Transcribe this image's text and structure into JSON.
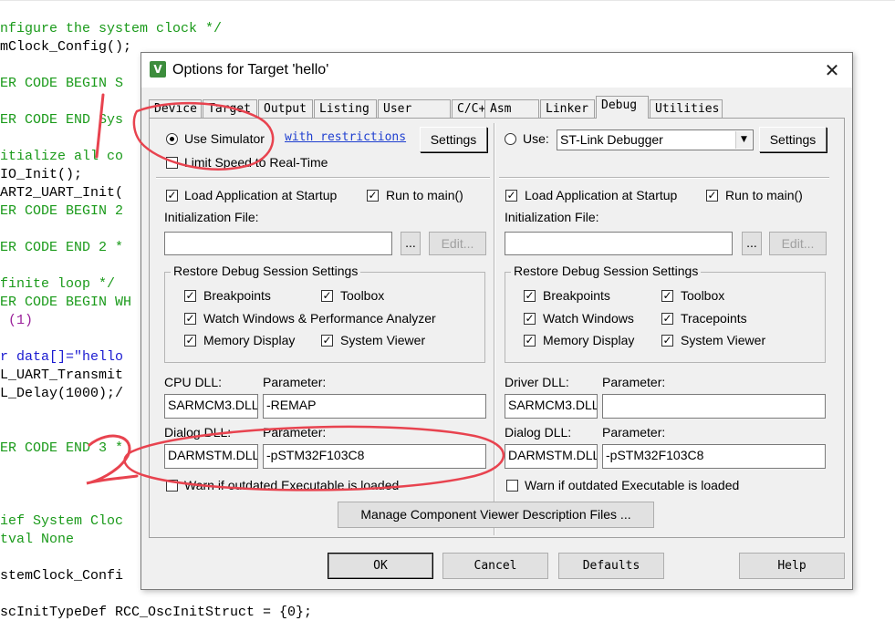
{
  "code": {
    "lines": [
      {
        "text": "nfigure the system clock */",
        "cls": "c-comment"
      },
      {
        "text": "mClock_Config();",
        "cls": ""
      },
      {
        "text": "ER CODE BEGIN S",
        "cls": "c-comment"
      },
      {
        "text": "ER CODE END Sys",
        "cls": "c-comment"
      },
      {
        "text": "itialize all co",
        "cls": "c-comment"
      },
      {
        "text": "IO_Init();",
        "cls": ""
      },
      {
        "text": "ART2_UART_Init(",
        "cls": ""
      },
      {
        "text": "ER CODE BEGIN 2",
        "cls": "c-comment"
      },
      {
        "text": "ER CODE END 2 *",
        "cls": "c-comment"
      },
      {
        "text": "finite loop */",
        "cls": "c-comment"
      },
      {
        "text": "ER CODE BEGIN WH",
        "cls": "c-comment"
      },
      {
        "text": " (1)",
        "cls": "c-num"
      },
      {
        "text": "r data[]=\"hello",
        "cls": "c-kw"
      },
      {
        "text": "L_UART_Transmit",
        "cls": ""
      },
      {
        "text": "L_Delay(1000);/",
        "cls": ""
      },
      {
        "text": "ER CODE END 3 *",
        "cls": "c-comment"
      },
      {
        "text": "ief System Cloc",
        "cls": "c-comment"
      },
      {
        "text": "tval None",
        "cls": "c-comment"
      },
      {
        "text": "stemClock_Confi",
        "cls": ""
      },
      {
        "text": "scInitTypeDef RCC_OscInitStruct = {0};",
        "cls": ""
      }
    ]
  },
  "dialog": {
    "title": "Options for Target 'hello'",
    "icon_label": "V",
    "close_label": "✕",
    "tabs": [
      "Device",
      "Target",
      "Output",
      "Listing",
      "User",
      "C/C++",
      "Asm",
      "Linker",
      "Debug",
      "Utilities"
    ],
    "active_tab": "Debug",
    "left": {
      "use_simulator": "Use Simulator",
      "with_restrictions": "with restrictions",
      "settings": "Settings",
      "limit_speed": "Limit Speed to Real-Time",
      "load_app": "Load Application at Startup",
      "run_to_main": "Run to main()",
      "init_file": "Initialization File:",
      "browse": "...",
      "edit": "Edit...",
      "restore_group": "Restore Debug Session Settings",
      "breakpoints": "Breakpoints",
      "toolbox": "Toolbox",
      "watch_windows": "Watch Windows & Performance Analyzer",
      "memory_display": "Memory Display",
      "system_viewer": "System Viewer",
      "cpu_dll_label": "CPU DLL:",
      "parameter_label": "Parameter:",
      "cpu_dll": "SARMCM3.DLL",
      "cpu_param": "-REMAP",
      "dialog_dll_label": "Dialog DLL:",
      "dialog_dll": "DARMSTM.DLL",
      "dialog_param": "-pSTM32F103C8",
      "warn_outdated": "Warn if outdated Executable is loaded"
    },
    "right": {
      "use": "Use:",
      "debugger": "ST-Link Debugger",
      "settings": "Settings",
      "load_app": "Load Application at Startup",
      "run_to_main": "Run to main()",
      "init_file": "Initialization File:",
      "browse": "...",
      "edit": "Edit...",
      "restore_group": "Restore Debug Session Settings",
      "breakpoints": "Breakpoints",
      "toolbox": "Toolbox",
      "watch_windows": "Watch Windows",
      "tracepoints": "Tracepoints",
      "memory_display": "Memory Display",
      "system_viewer": "System Viewer",
      "driver_dll_label": "Driver DLL:",
      "parameter_label": "Parameter:",
      "driver_dll": "SARMCM3.DLL",
      "driver_param": "",
      "dialog_dll_label": "Dialog DLL:",
      "dialog_dll": "DARMSTM.DLL",
      "dialog_param": "-pSTM32F103C8",
      "warn_outdated": "Warn if outdated Executable is loaded"
    },
    "manage_button": "Manage Component Viewer Description Files ...",
    "footer": {
      "ok": "OK",
      "cancel": "Cancel",
      "defaults": "Defaults",
      "help": "Help"
    }
  },
  "annotations": {
    "mark_1": "1",
    "mark_2": "2",
    "color": "#e8434f"
  }
}
